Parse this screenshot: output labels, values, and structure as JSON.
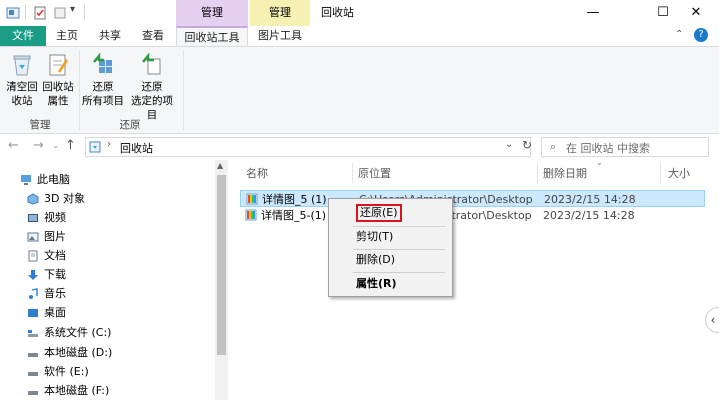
{
  "titlebar": {
    "window_title": "回收站",
    "context_tab_manage": "管理",
    "context_tab_tools": "管理",
    "minimize": "—",
    "maximize": "☐",
    "close": "✕"
  },
  "ribbon": {
    "tabs": [
      {
        "label": "文件"
      },
      {
        "label": "主页"
      },
      {
        "label": "共享"
      },
      {
        "label": "查看"
      },
      {
        "label": "回收站工具"
      },
      {
        "label": "图片工具"
      }
    ],
    "groups": {
      "manage": {
        "label": "管理",
        "buttons": [
          {
            "line1": "清空回",
            "line2": "收站"
          },
          {
            "line1": "回收站",
            "line2": "属性"
          }
        ]
      },
      "restore": {
        "label": "还原",
        "buttons": [
          {
            "line1": "还原",
            "line2": "所有项目"
          },
          {
            "line1": "还原",
            "line2": "选定的项目"
          }
        ]
      }
    }
  },
  "address": {
    "path": "回收站",
    "search_placeholder": "在 回收站 中搜索"
  },
  "sidebar": {
    "items": [
      {
        "label": "此电脑",
        "icon": "computer-icon"
      },
      {
        "label": "3D 对象",
        "icon": "cube-icon"
      },
      {
        "label": "视频",
        "icon": "video-icon"
      },
      {
        "label": "图片",
        "icon": "picture-icon"
      },
      {
        "label": "文档",
        "icon": "document-icon"
      },
      {
        "label": "下载",
        "icon": "download-icon"
      },
      {
        "label": "音乐",
        "icon": "music-icon"
      },
      {
        "label": "桌面",
        "icon": "desktop-icon"
      },
      {
        "label": "系统文件 (C:)",
        "icon": "drive-icon"
      },
      {
        "label": "本地磁盘 (D:)",
        "icon": "drive-icon"
      },
      {
        "label": "软件 (E:)",
        "icon": "drive-icon"
      },
      {
        "label": "本地磁盘 (F:)",
        "icon": "drive-icon"
      }
    ]
  },
  "table": {
    "columns": [
      "名称",
      "原位置",
      "删除日期",
      "大小"
    ],
    "rows": [
      {
        "name": "详情图_5 (1)",
        "location": "C:\\Users\\Administrator\\Desktop",
        "date": "2023/2/15 14:28",
        "selected": true
      },
      {
        "name": "详情图_5-(1)",
        "location": "C:\\Users\\Administrator\\Desktop",
        "date": "2023/2/15 14:28",
        "selected": false
      }
    ]
  },
  "context_menu": {
    "items": [
      {
        "label": "还原(E)"
      },
      {
        "label": "剪切(T)"
      },
      {
        "label": "删除(D)"
      },
      {
        "label": "属性(R)"
      }
    ]
  },
  "colors": {
    "accent": "#1979ca",
    "file_tab": "#1b9c85",
    "manage_context": "#e6d0f2",
    "tools_context": "#f6f1b3",
    "selection": "#cce8ff",
    "highlight_box": "#d9141c"
  }
}
